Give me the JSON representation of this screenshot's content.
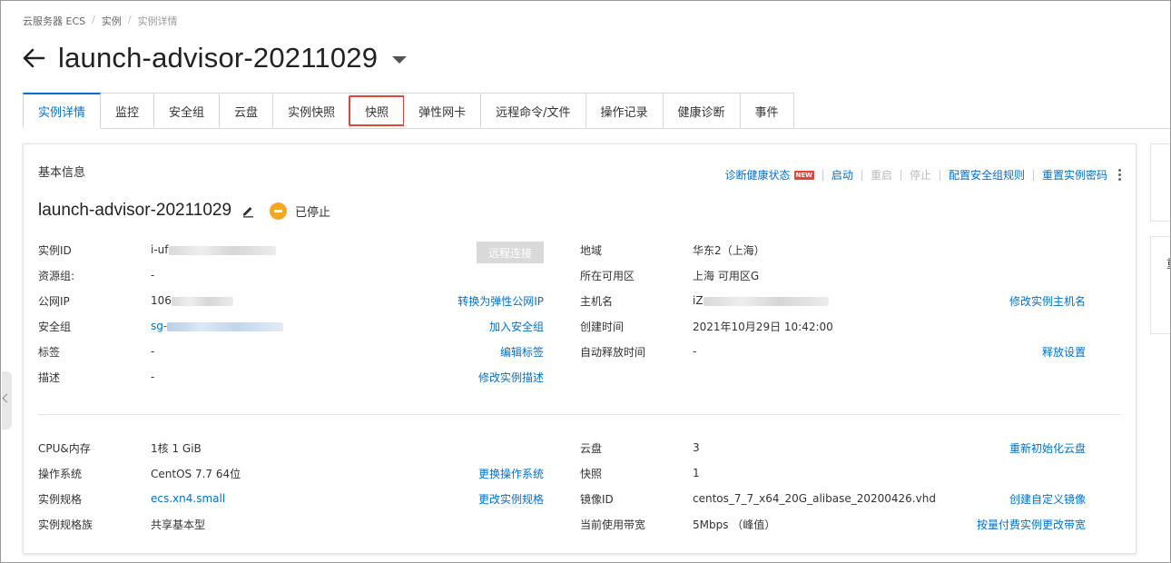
{
  "breadcrumb": [
    "云服务器 ECS",
    "实例",
    "实例详情"
  ],
  "title": "launch-advisor-20211029",
  "tabs": [
    {
      "label": "实例详情",
      "active": true
    },
    {
      "label": "监控"
    },
    {
      "label": "安全组"
    },
    {
      "label": "云盘"
    },
    {
      "label": "实例快照"
    },
    {
      "label": "快照",
      "highlighted": true
    },
    {
      "label": "弹性网卡"
    },
    {
      "label": "远程命令/文件"
    },
    {
      "label": "操作记录"
    },
    {
      "label": "健康诊断"
    },
    {
      "label": "事件"
    }
  ],
  "card": {
    "title": "基本信息",
    "actions": {
      "diagnose": "诊断健康状态",
      "new_badge": "NEW",
      "start": "启动",
      "restart": "重启",
      "stop": "停止",
      "config_sg": "配置安全组规则",
      "reset_pwd": "重置实例密码"
    },
    "instance_name": "launch-advisor-20211029",
    "status": "已停止",
    "status_color": "#f5a623",
    "remote_connect": "远程连接",
    "left": [
      {
        "label": "实例ID",
        "value": "i-uf"
      },
      {
        "label": "资源组:",
        "value": "-"
      },
      {
        "label": "公网IP",
        "value": "106",
        "action": "转换为弹性公网IP"
      },
      {
        "label": "安全组",
        "value": "sg-",
        "action": "加入安全组"
      },
      {
        "label": "标签",
        "value": "-",
        "action": "编辑标签"
      },
      {
        "label": "描述",
        "value": "-",
        "action": "修改实例描述"
      }
    ],
    "right": [
      {
        "label": "地域",
        "value": "华东2（上海）"
      },
      {
        "label": "所在可用区",
        "value": "上海 可用区G"
      },
      {
        "label": "主机名",
        "value": "iZ",
        "action": "修改实例主机名"
      },
      {
        "label": "创建时间",
        "value": "2021年10月29日 10:42:00"
      },
      {
        "label": "自动释放时间",
        "value": "-",
        "action": "释放设置"
      }
    ],
    "left2": [
      {
        "label": "CPU&内存",
        "value": "1核 1 GiB"
      },
      {
        "label": "操作系统",
        "value": "CentOS 7.7 64位",
        "action": "更换操作系统"
      },
      {
        "label": "实例规格",
        "value": "ecs.xn4.small",
        "action": "更改实例规格"
      },
      {
        "label": "实例规格族",
        "value": "共享基本型"
      }
    ],
    "right2": [
      {
        "label": "云盘",
        "value": "3",
        "action": "重新初始化云盘"
      },
      {
        "label": "快照",
        "value": "1"
      },
      {
        "label": "镜像ID",
        "value": "centos_7_7_x64_20G_alibase_20200426.vhd",
        "action": "创建自定义镜像"
      },
      {
        "label": "当前使用带宽",
        "value": "5Mbps （峰值）",
        "action": "按量付费实例更改带宽"
      }
    ]
  },
  "side_partial_char": "重"
}
